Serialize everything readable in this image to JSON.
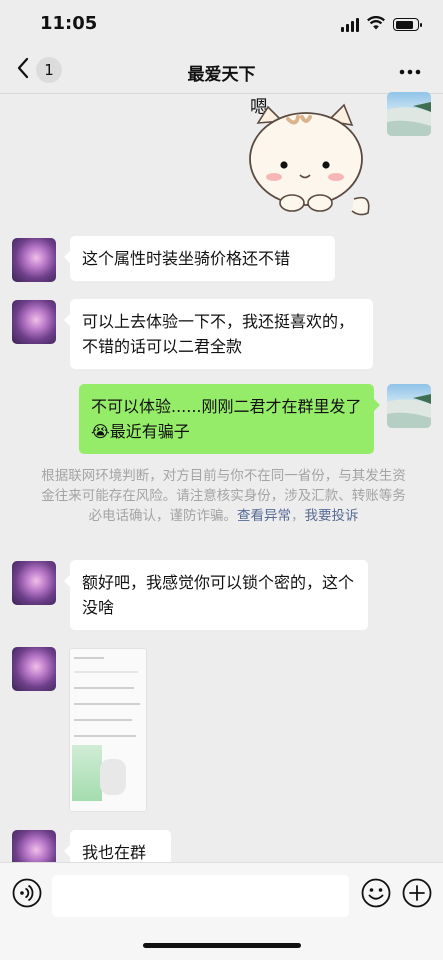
{
  "status_bar": {
    "time": "11:05"
  },
  "nav": {
    "unread_count": "1",
    "title": "最爱天下",
    "more_icon": "more-dots-icon"
  },
  "sticker": {
    "caption": "嗯",
    "description": "cat-sticker"
  },
  "messages": [
    {
      "from": "other",
      "text": "这个属性时装坐骑价格还不错"
    },
    {
      "from": "other",
      "text": "可以上去体验一下不，我还挺喜欢的，不错的话可以二君全款"
    },
    {
      "from": "self",
      "text": "不可以体验......刚刚二君才在群里发了😭最近有骗子"
    },
    {
      "from": "other",
      "text": "额好吧，我感觉你可以锁个密的，这个没啥"
    },
    {
      "from": "other",
      "type": "image"
    },
    {
      "from": "other",
      "text": "我也在群"
    }
  ],
  "notice": {
    "text": "根据联网环境判断，对方目前与你不在同一省份，与其发生资金往来可能存在风险。请注意核实身份，涉及汇款、转账等务必电话确认，谨防诈骗。",
    "link_check": "查看异常",
    "link_report": "我要投诉"
  },
  "input_bar": {
    "voice_icon": "voice-icon",
    "emoji_icon": "emoji-icon",
    "plus_icon": "plus-icon",
    "placeholder": ""
  },
  "colors": {
    "background": "#ededed",
    "self_bubble": "#95ec69",
    "other_bubble": "#ffffff",
    "link": "#576b95"
  }
}
